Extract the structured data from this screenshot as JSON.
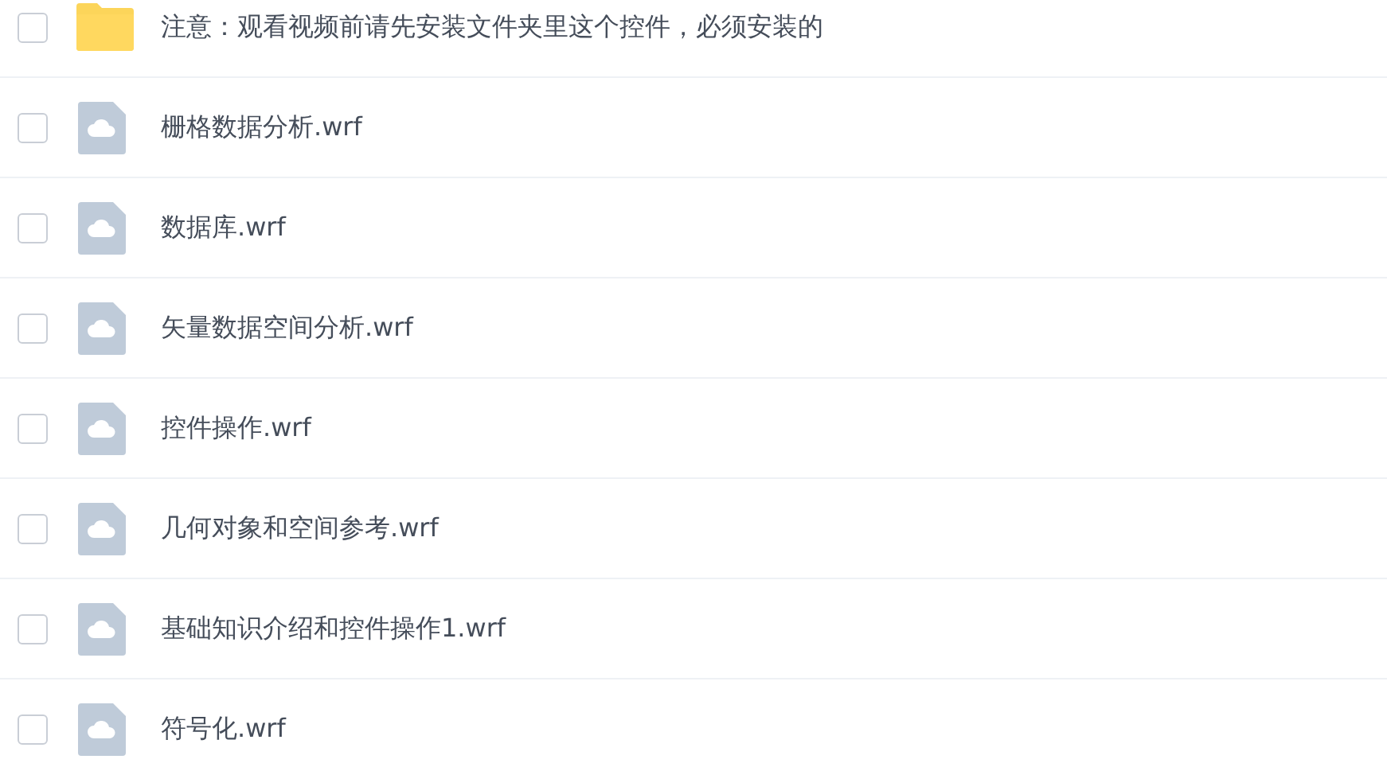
{
  "files": [
    {
      "kind": "folder",
      "name": "注意：观看视频前请先安装文件夹里这个控件，必须安装的",
      "checked": false
    },
    {
      "kind": "file",
      "name": "栅格数据分析.wrf",
      "checked": false
    },
    {
      "kind": "file",
      "name": "数据库.wrf",
      "checked": false
    },
    {
      "kind": "file",
      "name": "矢量数据空间分析.wrf",
      "checked": false
    },
    {
      "kind": "file",
      "name": "控件操作.wrf",
      "checked": false
    },
    {
      "kind": "file",
      "name": "几何对象和空间参考.wrf",
      "checked": false
    },
    {
      "kind": "file",
      "name": "基础知识介绍和控件操作1.wrf",
      "checked": false
    },
    {
      "kind": "file",
      "name": "符号化.wrf",
      "checked": false
    }
  ]
}
